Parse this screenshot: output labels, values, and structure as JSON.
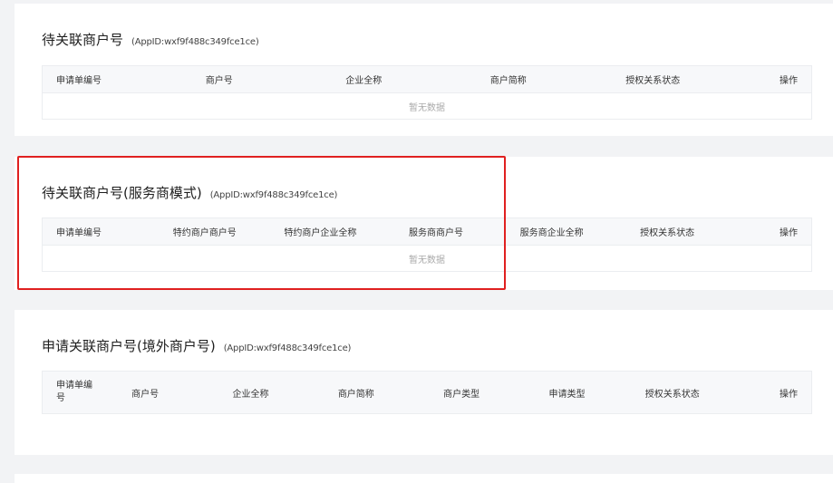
{
  "sections": [
    {
      "title": "待关联商户号",
      "appid": "(AppID:wxf9f488c349fce1ce)",
      "columns": [
        "申请单编号",
        "商户号",
        "企业全称",
        "商户简称",
        "授权关系状态",
        "操作"
      ],
      "empty_text": "暂无数据"
    },
    {
      "title": "待关联商户号(服务商模式)",
      "appid": "(AppID:wxf9f488c349fce1ce)",
      "columns": [
        "申请单编号",
        "特约商户商户号",
        "特约商户企业全称",
        "服务商商户号",
        "服务商企业全称",
        "授权关系状态",
        "操作"
      ],
      "empty_text": "暂无数据"
    },
    {
      "title": "申请关联商户号(境外商户号)",
      "appid": "(AppID:wxf9f488c349fce1ce)",
      "columns": [
        "申请单编号",
        "商户号",
        "企业全称",
        "商户简称",
        "商户类型",
        "申请类型",
        "授权关系状态",
        "操作"
      ]
    }
  ],
  "colors": {
    "highlight_border": "#e02020",
    "page_bg": "#f2f3f5",
    "header_bg": "#f7f8fa"
  }
}
